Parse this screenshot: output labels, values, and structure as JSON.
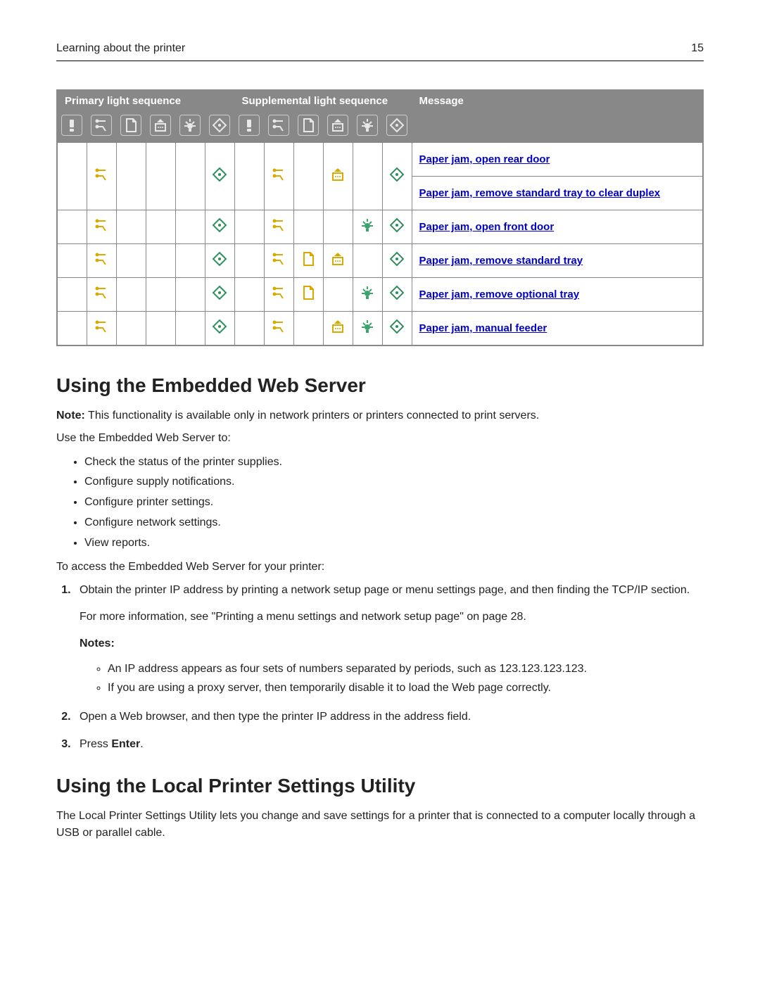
{
  "header": {
    "title": "Learning about the printer",
    "page_number": "15"
  },
  "table": {
    "col_primary": "Primary light sequence",
    "col_supplemental": "Supplemental light sequence",
    "col_message": "Message",
    "icons": [
      "error",
      "toner",
      "paper",
      "load",
      "light",
      "go"
    ],
    "rows": [
      {
        "primary": [
          false,
          true,
          false,
          false,
          false,
          true
        ],
        "supplemental": [
          false,
          true,
          false,
          true,
          false,
          true
        ],
        "messages": [
          "Paper jam, open rear door",
          "Paper jam, remove standard tray to clear duplex"
        ]
      },
      {
        "primary": [
          false,
          true,
          false,
          false,
          false,
          true
        ],
        "supplemental": [
          false,
          true,
          false,
          false,
          true,
          true
        ],
        "messages": [
          "Paper jam, open front door"
        ]
      },
      {
        "primary": [
          false,
          true,
          false,
          false,
          false,
          true
        ],
        "supplemental": [
          false,
          true,
          true,
          true,
          false,
          true
        ],
        "messages": [
          "Paper jam, remove standard tray"
        ]
      },
      {
        "primary": [
          false,
          true,
          false,
          false,
          false,
          true
        ],
        "supplemental": [
          false,
          true,
          true,
          false,
          true,
          true
        ],
        "messages": [
          "Paper jam, remove optional tray"
        ]
      },
      {
        "primary": [
          false,
          true,
          false,
          false,
          false,
          true
        ],
        "supplemental": [
          false,
          true,
          false,
          true,
          true,
          true
        ],
        "messages": [
          "Paper jam, manual feeder"
        ]
      }
    ]
  },
  "section1": {
    "title": "Using the Embedded Web Server",
    "note_label": "Note:",
    "note_text": " This functionality is available only in network printers or printers connected to print servers.",
    "intro": "Use the Embedded Web Server to:",
    "bullets": [
      "Check the status of the printer supplies.",
      "Configure supply notifications.",
      "Configure printer settings.",
      "Configure network settings.",
      "View reports."
    ],
    "access_intro": "To access the Embedded Web Server for your printer:",
    "step1_a": "Obtain the printer IP address by printing a network setup page or menu settings page, and then finding the TCP/IP section.",
    "step1_b": "For more information, see \"Printing a menu settings and network setup page\" on page 28.",
    "notes_label": "Notes:",
    "step1_notes": [
      "An IP address appears as four sets of numbers separated by periods, such as 123.123.123.123.",
      "If you are using a proxy server, then temporarily disable it to load the Web page correctly."
    ],
    "step2": "Open a Web browser, and then type the printer IP address in the address field.",
    "step3_a": "Press ",
    "step3_b": "Enter",
    "step3_c": "."
  },
  "section2": {
    "title": "Using the Local Printer Settings Utility",
    "text": "The Local Printer Settings Utility lets you change and save settings for a printer that is connected to a computer locally through a USB or parallel cable."
  }
}
